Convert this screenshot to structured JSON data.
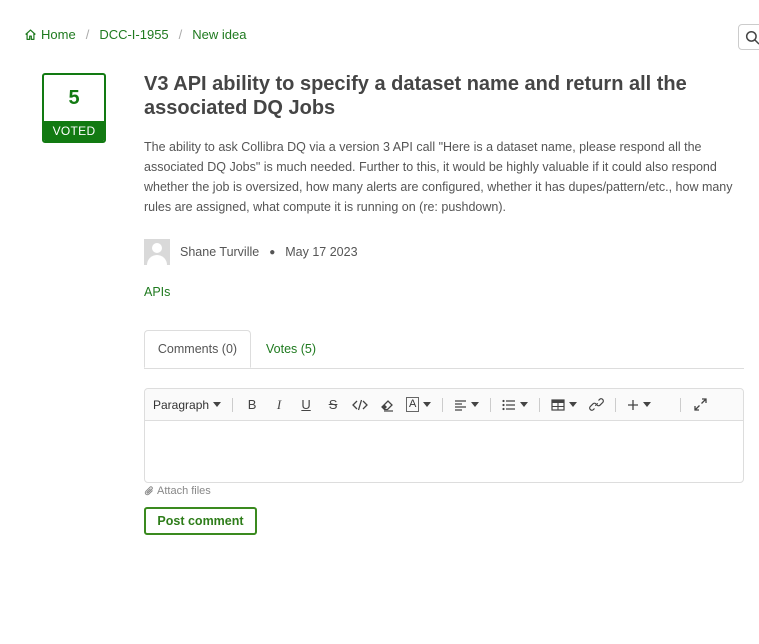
{
  "breadcrumb": {
    "home": "Home",
    "project": "DCC-I-1955",
    "status": "New idea"
  },
  "vote": {
    "count": "5",
    "label": "VOTED"
  },
  "idea": {
    "title": "V3 API ability to specify a dataset name and return all the associated DQ Jobs",
    "description": "The ability to ask Collibra DQ via a version 3 API call \"Here is a dataset name, please respond all the associated DQ Jobs\" is much needed. Further to this, it would be highly valuable if it could also respond whether the job is oversized, how many alerts are configured, whether it has dupes/pattern/etc., how many rules are assigned, what compute it is running on (re: pushdown).",
    "author": "Shane Turville",
    "date": "May 17 2023",
    "category": "APIs"
  },
  "tabs": [
    {
      "label": "Comments (0)"
    },
    {
      "label": "Votes (5)"
    }
  ],
  "editor": {
    "format_label": "Paragraph",
    "font_color_glyph": "A",
    "attach_label": "Attach files",
    "post_label": "Post comment"
  },
  "colors": {
    "accent": "#127a12",
    "link": "#1f7a1f"
  }
}
